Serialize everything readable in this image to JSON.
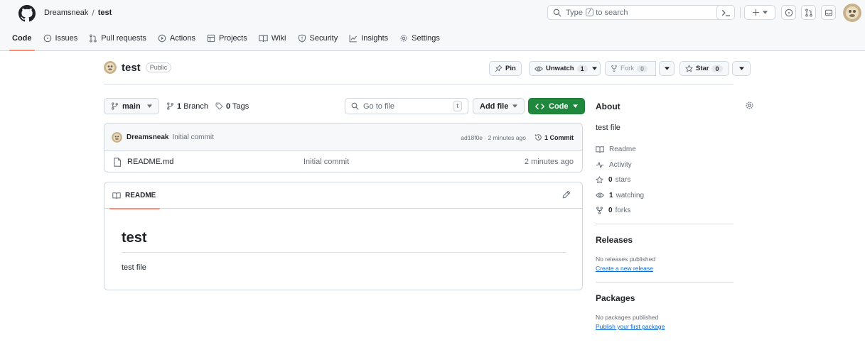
{
  "header": {
    "owner": "Dreamsneak",
    "separator": "/",
    "repo": "test",
    "search_prefix": "Type",
    "search_key": "/",
    "search_suffix": "to search",
    "cmd_icon": "terminal-icon",
    "plus_icon": "plus-icon"
  },
  "tabs": [
    {
      "label": "Code",
      "icon": "code-icon",
      "active": true
    },
    {
      "label": "Issues",
      "icon": "issue-opened-icon"
    },
    {
      "label": "Pull requests",
      "icon": "git-pull-request-icon"
    },
    {
      "label": "Actions",
      "icon": "play-icon"
    },
    {
      "label": "Projects",
      "icon": "table-icon"
    },
    {
      "label": "Wiki",
      "icon": "book-icon"
    },
    {
      "label": "Security",
      "icon": "shield-icon"
    },
    {
      "label": "Insights",
      "icon": "graph-icon"
    },
    {
      "label": "Settings",
      "icon": "gear-icon"
    }
  ],
  "repo_header": {
    "name": "test",
    "visibility": "Public",
    "pin_label": "Pin",
    "unwatch_label": "Unwatch",
    "watch_count": "1",
    "fork_label": "Fork",
    "fork_count": "0",
    "star_label": "Star",
    "star_count": "0"
  },
  "file_nav": {
    "branch": "main",
    "branch_count": "1",
    "branch_label": "Branch",
    "tag_count": "0",
    "tag_label": "Tags",
    "goto_placeholder": "Go to file",
    "goto_key": "t",
    "add_file_label": "Add file",
    "code_label": "Code"
  },
  "latest_commit": {
    "author": "Dreamsneak",
    "message": "Initial commit",
    "sha_time": "ad18f0e · 2 minutes ago",
    "commit_count_label": "1 Commit"
  },
  "files": [
    {
      "name": "README.md",
      "commit_message": "Initial commit",
      "age": "2 minutes ago",
      "icon": "file-icon"
    }
  ],
  "readme": {
    "tab_label": "README",
    "heading": "test",
    "body": "test file"
  },
  "sidebar": {
    "about_title": "About",
    "description": "test file",
    "items": [
      {
        "icon": "book-icon",
        "label": "Readme",
        "count": ""
      },
      {
        "icon": "pulse-icon",
        "label": "Activity",
        "count": ""
      },
      {
        "icon": "star-icon",
        "label": "stars",
        "count": "0"
      },
      {
        "icon": "eye-icon",
        "label": "watching",
        "count": "1"
      },
      {
        "icon": "repo-forked-icon",
        "label": "forks",
        "count": "0"
      }
    ],
    "releases_title": "Releases",
    "releases_note": "No releases published",
    "releases_link": "Create a new release",
    "packages_title": "Packages",
    "packages_note": "No packages published",
    "packages_link": "Publish your first package"
  },
  "colors": {
    "accent_underline": "#fd8c73",
    "code_button_bg": "#1f883d",
    "link": "#0969da",
    "header_bg": "#f6f8fa",
    "border": "#d0d7de"
  }
}
